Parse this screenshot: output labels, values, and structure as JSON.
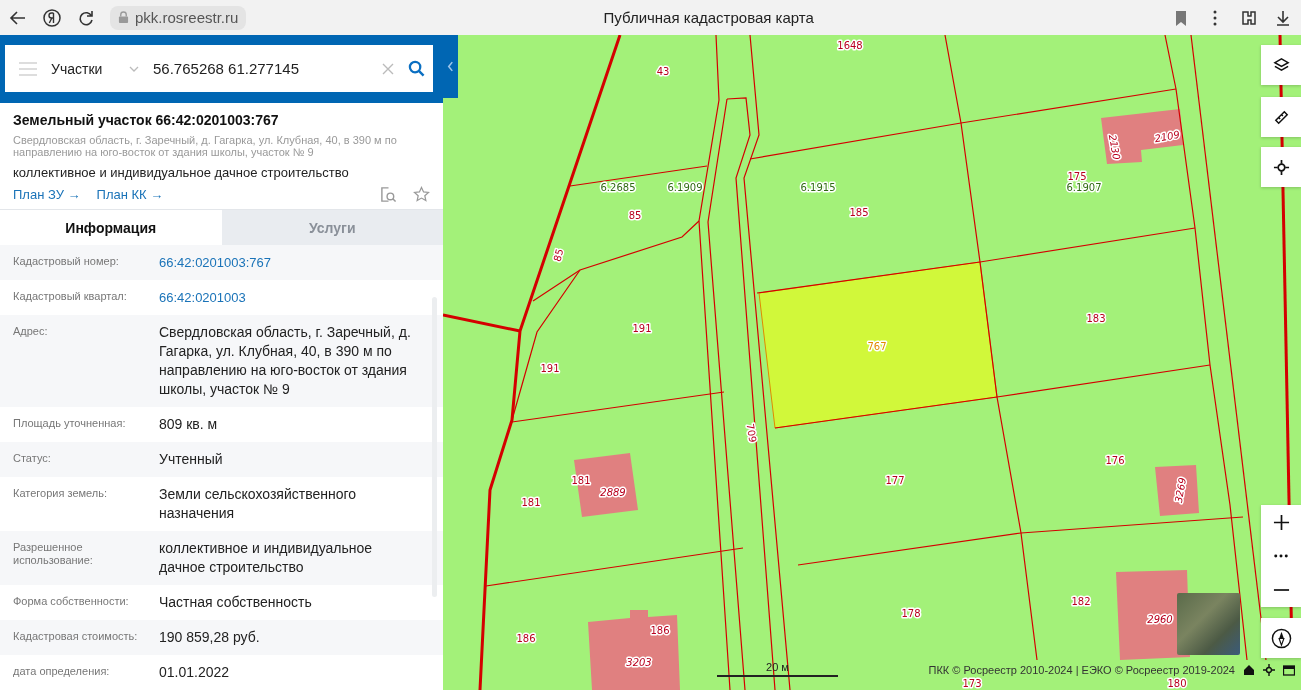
{
  "browser": {
    "url": "pkk.rosreestr.ru",
    "title": "Публичная кадастровая карта"
  },
  "search": {
    "category": "Участки",
    "value": "56.765268 61.277145"
  },
  "object": {
    "title": "Земельный участок 66:42:0201003:767",
    "address": "Свердловская область, г. Заречный, д. Гагарка, ул. Клубная, 40, в 390 м по направлению на юго-восток от здания школы, участок № 9",
    "usage": "коллективное и индивидуальное дачное строительство",
    "links": [
      "План ЗУ →",
      "План КК →"
    ]
  },
  "tabs": [
    {
      "label": "Информация",
      "selected": true
    },
    {
      "label": "Услуги",
      "selected": false
    }
  ],
  "info": [
    {
      "label": "Кадастровый номер:",
      "value": "66:42:0201003:767",
      "kind": "link"
    },
    {
      "label": "Кадастровый квартал:",
      "value": "66:42:0201003",
      "kind": "link"
    },
    {
      "label": "Адрес:",
      "value": "Свердловская область, г. Заречный, д. Гагарка, ул. Клубная, 40, в 390 м по направлению на юго-восток от здания школы, участок № 9",
      "kind": "text"
    },
    {
      "label": "Площадь уточненная:",
      "value": "809 кв. м",
      "kind": "text"
    },
    {
      "label": "Статус:",
      "value": "Учтенный",
      "kind": "text"
    },
    {
      "label": "Категория земель:",
      "value": "Земли сельскохозяйственного назначения",
      "kind": "text"
    },
    {
      "label": "Разрешенное использование:",
      "value": "коллективное и индивидуальное дачное строительство",
      "kind": "text"
    },
    {
      "label": "Форма собственности:",
      "value": "Частная собственность",
      "kind": "text"
    },
    {
      "label": "Кадастровая стоимость:",
      "value": "190 859,28 руб.",
      "kind": "text"
    },
    {
      "label": "дата определения:",
      "value": "01.01.2022",
      "kind": "text"
    }
  ],
  "map": {
    "labels": [
      {
        "text": "1648",
        "kind": "parcel"
      },
      {
        "text": "43",
        "kind": "parcel"
      },
      {
        "text": "6.2685",
        "kind": "quarter"
      },
      {
        "text": "6.1909",
        "kind": "quarter"
      },
      {
        "text": "6.1915",
        "kind": "quarter"
      },
      {
        "text": "85",
        "kind": "parcel"
      },
      {
        "text": "185",
        "kind": "parcel"
      },
      {
        "text": "85",
        "kind": "parcel"
      },
      {
        "text": "175",
        "kind": "parcel"
      },
      {
        "text": "6.1907",
        "kind": "quarter"
      },
      {
        "text": "2130",
        "kind": "building"
      },
      {
        "text": "2109",
        "kind": "building"
      },
      {
        "text": "183",
        "kind": "parcel"
      },
      {
        "text": "191",
        "kind": "parcel"
      },
      {
        "text": "767",
        "kind": "selected"
      },
      {
        "text": "191",
        "kind": "parcel"
      },
      {
        "text": "709",
        "kind": "parcel"
      },
      {
        "text": "177",
        "kind": "parcel"
      },
      {
        "text": "176",
        "kind": "parcel"
      },
      {
        "text": "181",
        "kind": "parcel"
      },
      {
        "text": "2889",
        "kind": "building"
      },
      {
        "text": "181",
        "kind": "parcel"
      },
      {
        "text": "3269",
        "kind": "building"
      },
      {
        "text": "186",
        "kind": "parcel"
      },
      {
        "text": "186",
        "kind": "parcel"
      },
      {
        "text": "3203",
        "kind": "building"
      },
      {
        "text": "178",
        "kind": "parcel"
      },
      {
        "text": "182",
        "kind": "parcel"
      },
      {
        "text": "2960",
        "kind": "building"
      },
      {
        "text": "173",
        "kind": "parcel"
      },
      {
        "text": "180",
        "kind": "parcel"
      }
    ],
    "scale": "20 м",
    "attribution": "ПКК © Росреестр 2010-2024 | ЕЭКО © Росреестр 2019-2024"
  }
}
